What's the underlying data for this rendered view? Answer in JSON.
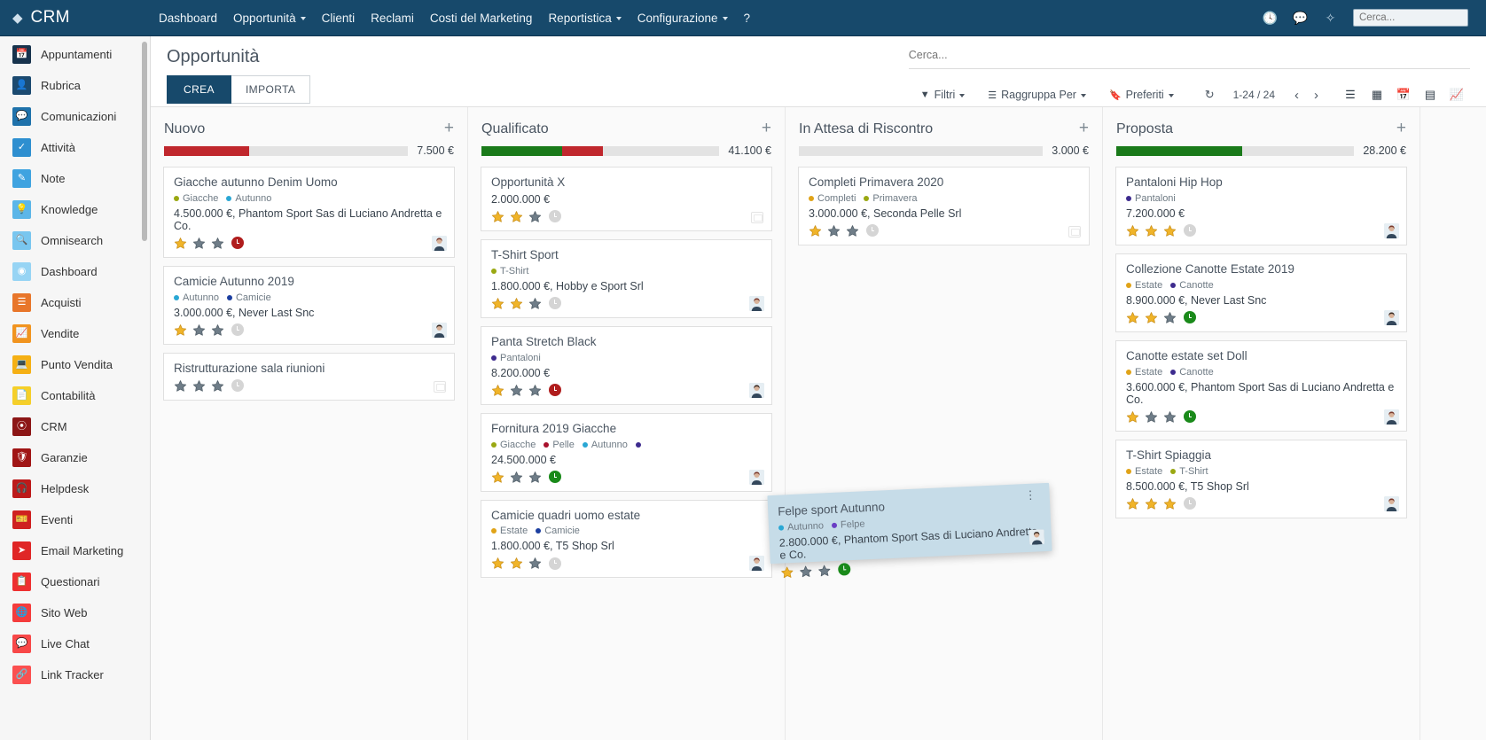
{
  "navbar": {
    "brand": "CRM",
    "brand_icon": "tag-icon",
    "links": [
      {
        "label": "Dashboard",
        "caret": false
      },
      {
        "label": "Opportunità",
        "caret": true
      },
      {
        "label": "Clienti",
        "caret": false
      },
      {
        "label": "Reclami",
        "caret": false
      },
      {
        "label": "Costi del Marketing",
        "caret": false
      },
      {
        "label": "Reportistica",
        "caret": true
      },
      {
        "label": "Configurazione",
        "caret": true
      },
      {
        "label": "?",
        "caret": false
      }
    ],
    "right_icons": [
      "clock-icon",
      "chat-icon",
      "loading-spinner-icon"
    ],
    "search_placeholder": "Cerca..."
  },
  "sidebar": {
    "items": [
      {
        "label": "Appuntamenti",
        "icon": "calendar-icon",
        "color": "#17334d"
      },
      {
        "label": "Rubrica",
        "icon": "address-book-icon",
        "color": "#1b4a70"
      },
      {
        "label": "Comunicazioni",
        "icon": "comment-icon",
        "color": "#1f72ab"
      },
      {
        "label": "Attività",
        "icon": "check-square-icon",
        "color": "#2e8fd0"
      },
      {
        "label": "Note",
        "icon": "note-edit-icon",
        "color": "#3fa3e0"
      },
      {
        "label": "Knowledge",
        "icon": "lightbulb-icon",
        "color": "#5cb6e8"
      },
      {
        "label": "Omnisearch",
        "icon": "magnifier-icon",
        "color": "#79c6ef"
      },
      {
        "label": "Dashboard",
        "icon": "gauge-icon",
        "color": "#97d4f4"
      },
      {
        "label": "Acquisti",
        "icon": "cart-list-icon",
        "color": "#e8762a"
      },
      {
        "label": "Vendite",
        "icon": "chart-line-icon",
        "color": "#f1941f"
      },
      {
        "label": "Punto Vendita",
        "icon": "monitor-icon",
        "color": "#f5b014"
      },
      {
        "label": "Contabilità",
        "icon": "book-icon",
        "color": "#f5cf2a"
      },
      {
        "label": "CRM",
        "icon": "crm-swirl-icon",
        "color": "#8c1616"
      },
      {
        "label": "Garanzie",
        "icon": "shield-icon",
        "color": "#a01515"
      },
      {
        "label": "Helpdesk",
        "icon": "headset-icon",
        "color": "#bc1a1a"
      },
      {
        "label": "Eventi",
        "icon": "ticket-icon",
        "color": "#cf2020"
      },
      {
        "label": "Email Marketing",
        "icon": "paper-plane-icon",
        "color": "#e02626"
      },
      {
        "label": "Questionari",
        "icon": "clipboard-icon",
        "color": "#ee3030"
      },
      {
        "label": "Sito Web",
        "icon": "globe-icon",
        "color": "#f43c3c"
      },
      {
        "label": "Live Chat",
        "icon": "chat-bubble-icon",
        "color": "#f84848"
      },
      {
        "label": "Link Tracker",
        "icon": "link-icon",
        "color": "#fb5050"
      }
    ]
  },
  "control_bar": {
    "page_title": "Opportunità",
    "create_label": "CREA",
    "import_label": "IMPORTA",
    "search_placeholder": "Cerca...",
    "search_value": "",
    "filters_label": "Filtri",
    "groupby_label": "Raggruppa Per",
    "favorites_label": "Preferiti",
    "refresh_icon": "refresh-icon",
    "pagination": "1-24 / 24",
    "prev_icon": "chevron-left-icon",
    "next_icon": "chevron-right-icon",
    "views": [
      "list-view-icon",
      "kanban-view-icon",
      "calendar-view-icon",
      "pivot-view-icon",
      "graph-view-icon"
    ]
  },
  "kanban": {
    "columns": [
      {
        "title": "Nuovo",
        "total": "7.500 €",
        "bar": [
          {
            "color": "#c0272d",
            "pct": 35
          }
        ],
        "cards": [
          {
            "title": "Giacche autunno Denim Uomo",
            "tags": [
              {
                "label": "Giacche",
                "color": "#9aa812"
              },
              {
                "label": "Autunno",
                "color": "#2aa7d4"
              }
            ],
            "amount": "4.500.000 €, Phantom Sport Sas di Luciano Andretta e Co.",
            "stars": [
              1,
              0,
              0
            ],
            "badge_color": "#b01d1d",
            "avatar": "user-avatar-female"
          },
          {
            "title": "Camicie Autunno 2019",
            "tags": [
              {
                "label": "Autunno",
                "color": "#2aa7d4"
              },
              {
                "label": "Camicie",
                "color": "#1c3fa0"
              }
            ],
            "amount": "3.000.000 €, Never Last Snc",
            "stars": [
              1,
              0,
              0
            ],
            "badge_color": "#d5d5d5",
            "avatar": "user-avatar-male"
          },
          {
            "title": "Ristrutturazione sala riunioni",
            "tags": [],
            "amount": "",
            "stars": [
              0,
              0,
              0
            ],
            "badge_color": "#d5d5d5",
            "avatar": "placeholder"
          }
        ]
      },
      {
        "title": "Qualificato",
        "total": "41.100 €",
        "bar": [
          {
            "color": "#1a7a1a",
            "pct": 34
          },
          {
            "color": "#c0272d",
            "pct": 17
          }
        ],
        "cards": [
          {
            "title": "Opportunità X",
            "tags": [],
            "amount": "2.000.000 €",
            "stars": [
              1,
              1,
              0
            ],
            "badge_color": "#d5d5d5",
            "avatar": "placeholder"
          },
          {
            "title": "T-Shirt Sport",
            "tags": [
              {
                "label": "T-Shirt",
                "color": "#9aa812"
              }
            ],
            "amount": "1.800.000 €, Hobby e Sport Srl",
            "stars": [
              1,
              1,
              0
            ],
            "badge_color": "#d5d5d5",
            "avatar": "user-avatar-female"
          },
          {
            "title": "Panta Stretch Black",
            "tags": [
              {
                "label": "Pantaloni",
                "color": "#3d2b8e"
              }
            ],
            "amount": "8.200.000 €",
            "stars": [
              1,
              0,
              0
            ],
            "badge_color": "#b01d1d",
            "avatar": "user-avatar-male"
          },
          {
            "title": "Fornitura 2019 Giacche",
            "tags": [
              {
                "label": "Giacche",
                "color": "#9aa812"
              },
              {
                "label": "Pelle",
                "color": "#a8112c"
              },
              {
                "label": "Autunno",
                "color": "#2aa7d4"
              },
              {
                "label": "",
                "color": "#3d2b8e"
              }
            ],
            "amount": "24.500.000 €",
            "stars": [
              1,
              0,
              0
            ],
            "badge_color": "#1a8a1a",
            "avatar": "user-avatar-female"
          },
          {
            "title": "Camicie quadri uomo estate",
            "tags": [
              {
                "label": "Estate",
                "color": "#e0a318"
              },
              {
                "label": "Camicie",
                "color": "#1c3fa0"
              }
            ],
            "amount": "1.800.000 €, T5 Shop Srl",
            "stars": [
              1,
              1,
              0
            ],
            "badge_color": "#d5d5d5",
            "avatar": "user-avatar-female"
          }
        ]
      },
      {
        "title": "In Attesa di Riscontro",
        "total": "3.000 €",
        "bar": [],
        "cards": [
          {
            "title": "Completi Primavera 2020",
            "tags": [
              {
                "label": "Completi",
                "color": "#e0a318"
              },
              {
                "label": "Primavera",
                "color": "#9aa812"
              }
            ],
            "amount": "3.000.000 €, Seconda Pelle Srl",
            "stars": [
              1,
              0,
              0
            ],
            "badge_color": "#d5d5d5",
            "avatar": "placeholder"
          }
        ]
      },
      {
        "title": "Proposta",
        "total": "28.200 €",
        "bar": [
          {
            "color": "#1a7a1a",
            "pct": 53
          }
        ],
        "cards": [
          {
            "title": "Pantaloni Hip Hop",
            "tags": [
              {
                "label": "Pantaloni",
                "color": "#3d2b8e"
              }
            ],
            "amount": "7.200.000 €",
            "stars": [
              1,
              1,
              1
            ],
            "badge_color": "#d5d5d5",
            "avatar": "user-avatar-female"
          },
          {
            "title": "Collezione Canotte Estate 2019",
            "tags": [
              {
                "label": "Estate",
                "color": "#e0a318"
              },
              {
                "label": "Canotte",
                "color": "#3d2b8e"
              }
            ],
            "amount": "8.900.000 €, Never Last Snc",
            "stars": [
              1,
              1,
              0
            ],
            "badge_color": "#1a8a1a",
            "avatar": "user-avatar-male"
          },
          {
            "title": "Canotte estate set Doll",
            "tags": [
              {
                "label": "Estate",
                "color": "#e0a318"
              },
              {
                "label": "Canotte",
                "color": "#3d2b8e"
              }
            ],
            "amount": "3.600.000 €, Phantom Sport Sas di Luciano Andretta e Co.",
            "stars": [
              1,
              0,
              0
            ],
            "badge_color": "#1a8a1a",
            "avatar": "user-avatar-female"
          },
          {
            "title": "T-Shirt Spiaggia",
            "tags": [
              {
                "label": "Estate",
                "color": "#e0a318"
              },
              {
                "label": "T-Shirt",
                "color": "#9aa812"
              }
            ],
            "amount": "8.500.000 €, T5 Shop Srl",
            "stars": [
              1,
              1,
              1
            ],
            "badge_color": "#d5d5d5",
            "avatar": "user-avatar-female"
          }
        ]
      }
    ],
    "drag_card": {
      "title": "Felpe sport Autunno",
      "tags": [
        {
          "label": "Autunno",
          "color": "#2aa7d4"
        },
        {
          "label": "Felpe",
          "color": "#6a3ec4"
        }
      ],
      "amount": "2.800.000 €, Phantom Sport Sas di Luciano Andretta e Co.",
      "stars": [
        1,
        0,
        0
      ],
      "badge_color": "#1a8a1a",
      "menu_icon": "kebab-menu-icon"
    }
  }
}
